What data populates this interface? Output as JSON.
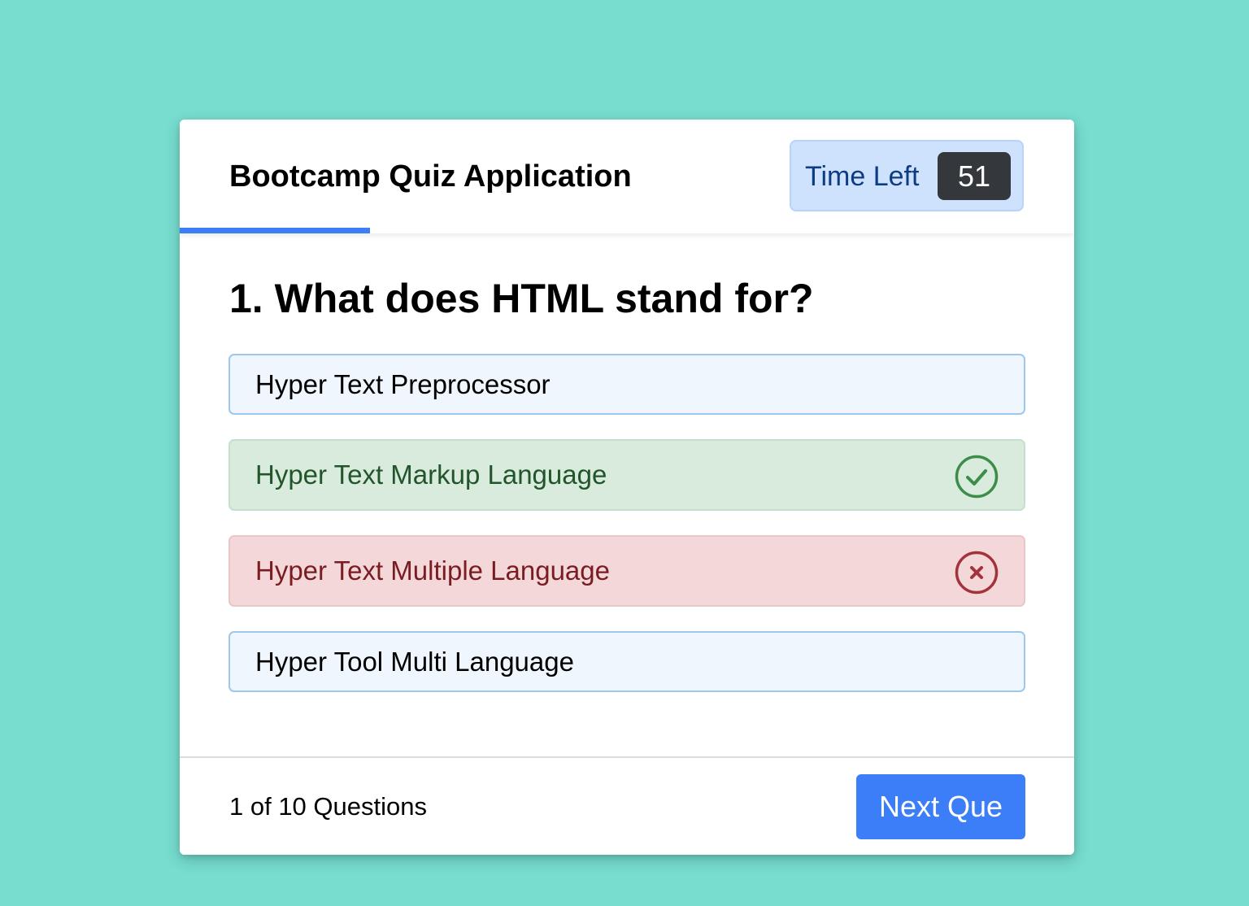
{
  "header": {
    "title": "Bootcamp Quiz Application",
    "timer_label": "Time Left",
    "timer_value": "51"
  },
  "progress": {
    "fraction": 0.2127
  },
  "question": {
    "text": "1. What does HTML stand for?"
  },
  "options": [
    {
      "label": "Hyper Text Preprocessor",
      "state": "neutral"
    },
    {
      "label": "Hyper Text Markup Language",
      "state": "correct",
      "icon": "check-circle-icon"
    },
    {
      "label": "Hyper Text Multiple Language",
      "state": "wrong",
      "icon": "cross-circle-icon"
    },
    {
      "label": "Hyper Tool Multi Language",
      "state": "neutral"
    }
  ],
  "footer": {
    "counter": "1 of 10 Questions",
    "next_label": "Next Que"
  },
  "colors": {
    "background": "#76ddcf",
    "accent": "#3b7ef7",
    "correct": "#3c8c4a",
    "wrong": "#a3323a",
    "timer_bg": "#cfe2fd",
    "timer_badge": "#34383d"
  }
}
